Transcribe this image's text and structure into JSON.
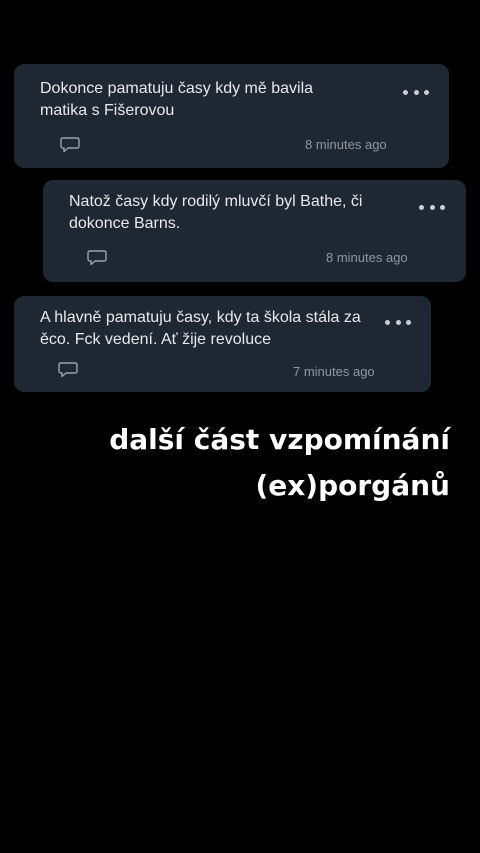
{
  "comments": [
    {
      "text": "Dokonce pamatuju časy kdy mě bavila\nmatika s Fišerovou",
      "time": "8 minutes ago",
      "reply_icon": "speech-bubble-icon",
      "menu_icon": "ellipsis-icon"
    },
    {
      "text": "Natož časy kdy rodilý mluvčí byl Bathe, či\ndokonce Barns.",
      "time": "8 minutes ago",
      "reply_icon": "speech-bubble-icon",
      "menu_icon": "ellipsis-icon"
    },
    {
      "text": "A hlavně pamatuju časy, kdy ta škola stála za\něco. Fck vedení. Ať žije revoluce",
      "time": "7 minutes ago",
      "reply_icon": "speech-bubble-icon",
      "menu_icon": "ellipsis-icon"
    }
  ],
  "caption": {
    "line1": "další část vzpomínání",
    "line2": "(ex)porgánů"
  },
  "colors": {
    "background": "#000000",
    "card": "#1f2732",
    "text": "#e6eaef",
    "muted": "#8d97a3",
    "caption": "#ffffff"
  }
}
